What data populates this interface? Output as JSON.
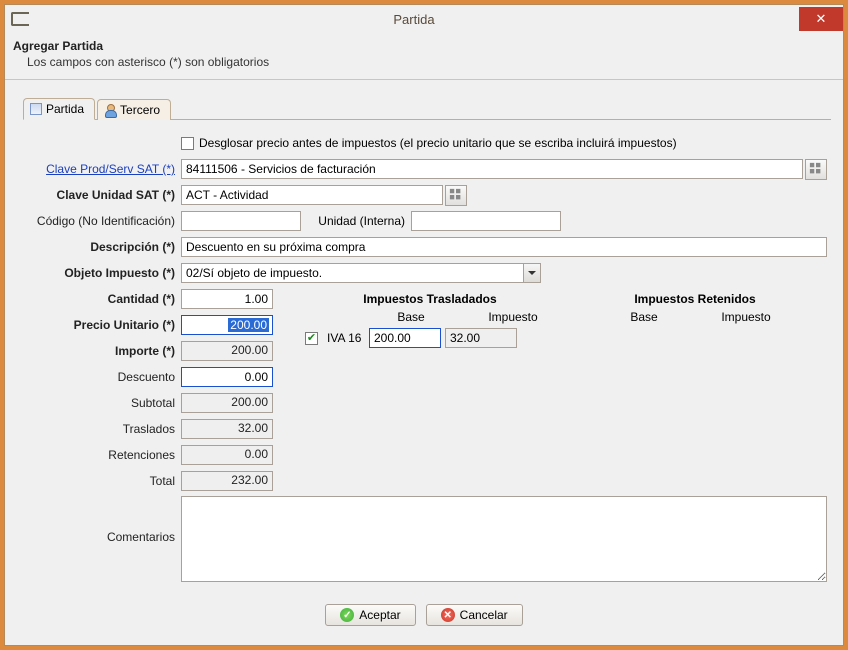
{
  "window": {
    "title": "Partida"
  },
  "header": {
    "title": "Agregar Partida",
    "subtitle": "Los campos con asterisco (*) son obligatorios"
  },
  "tabs": {
    "partida": "Partida",
    "tercero": "Tercero"
  },
  "form": {
    "desglosar_label": "Desglosar precio antes de impuestos (el precio unitario que se escriba incluirá impuestos)",
    "clave_prod_label": "Clave Prod/Serv SAT (*)",
    "clave_prod_value": "84111506 - Servicios de facturación",
    "clave_unidad_label": "Clave Unidad SAT (*)",
    "clave_unidad_value": "ACT - Actividad",
    "codigo_label": "Código (No Identificación)",
    "codigo_value": "",
    "unidad_interna_label": "Unidad (Interna)",
    "unidad_interna_value": "",
    "descripcion_label": "Descripción (*)",
    "descripcion_value": "Descuento en su próxima compra",
    "objeto_label": "Objeto Impuesto (*)",
    "objeto_value": "02/Sí objeto de impuesto.",
    "cantidad_label": "Cantidad (*)",
    "cantidad_value": "1.00",
    "precio_label": "Precio Unitario (*)",
    "precio_value": "200.00",
    "importe_label": "Importe (*)",
    "importe_value": "200.00",
    "descuento_label": "Descuento",
    "descuento_value": "0.00",
    "subtotal_label": "Subtotal",
    "subtotal_value": "200.00",
    "traslados_label": "Traslados",
    "traslados_value": "32.00",
    "retenciones_label": "Retenciones",
    "retenciones_value": "0.00",
    "total_label": "Total",
    "total_value": "232.00",
    "comentarios_label": "Comentarios",
    "comentarios_value": ""
  },
  "taxes": {
    "trasladados_title": "Impuestos Trasladados",
    "retenidos_title": "Impuestos Retenidos",
    "base_label": "Base",
    "impuesto_label": "Impuesto",
    "iva16_label": "IVA 16",
    "iva16_base": "200.00",
    "iva16_impuesto": "32.00"
  },
  "buttons": {
    "aceptar": "Aceptar",
    "cancelar": "Cancelar"
  }
}
